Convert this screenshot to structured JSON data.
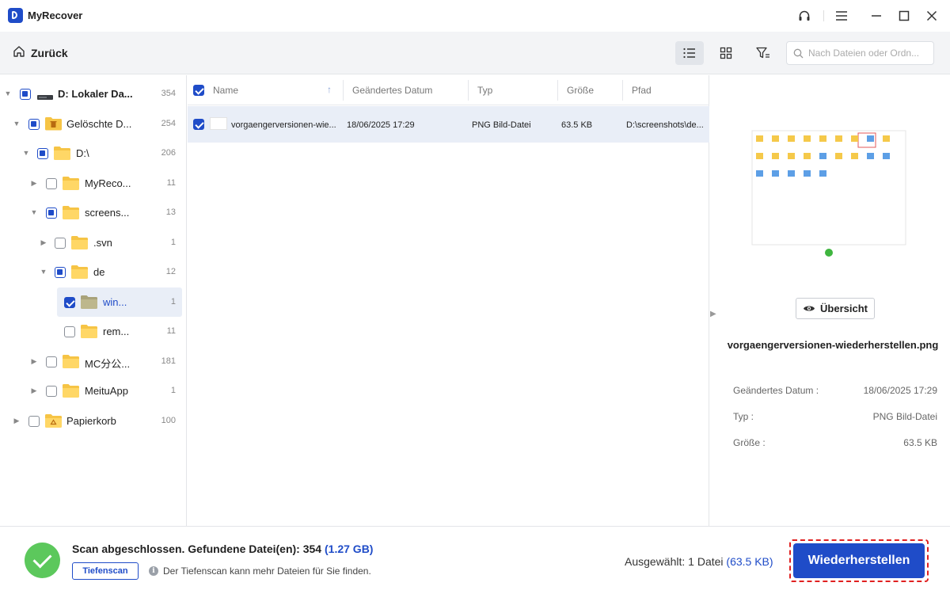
{
  "app": {
    "title": "MyRecover"
  },
  "toolbar": {
    "back_label": "Zurück",
    "search_placeholder": "Nach Dateien oder Ordn..."
  },
  "tree": [
    {
      "label": "D: Lokaler Da...",
      "count": "354"
    },
    {
      "label": "Gelöschte D...",
      "count": "254"
    },
    {
      "label": "D:\\",
      "count": "206"
    },
    {
      "label": "MyReco...",
      "count": "11"
    },
    {
      "label": "screens...",
      "count": "13"
    },
    {
      "label": ".svn",
      "count": "1"
    },
    {
      "label": "de",
      "count": "12"
    },
    {
      "label": "win...",
      "count": "1"
    },
    {
      "label": "rem...",
      "count": "11"
    },
    {
      "label": "MC分公...",
      "count": "181"
    },
    {
      "label": "MeituApp",
      "count": "1"
    },
    {
      "label": "Papierkorb",
      "count": "100"
    }
  ],
  "columns": {
    "name": "Name",
    "modified": "Geändertes Datum",
    "type": "Typ",
    "size": "Größe",
    "path": "Pfad"
  },
  "files": [
    {
      "name": "vorgaengerversionen-wie...",
      "modified": "18/06/2025 17:29",
      "type": "PNG Bild-Datei",
      "size": "63.5 KB",
      "path": "D:\\screenshots\\de..."
    }
  ],
  "preview": {
    "overview_label": "Übersicht",
    "filename": "vorgaengerversionen-wiederherstellen.png",
    "modified_label": "Geändertes Datum :",
    "modified_value": "18/06/2025 17:29",
    "type_label": "Typ :",
    "type_value": "PNG Bild-Datei",
    "size_label": "Größe :",
    "size_value": "63.5 KB"
  },
  "footer": {
    "scan_status": "Scan abgeschlossen. Gefundene Datei(en): 354",
    "scan_size": "(1.27 GB)",
    "deep_scan_label": "Tiefenscan",
    "hint": "Der Tiefenscan kann mehr Dateien für Sie finden.",
    "selected_label": "Ausgewählt: 1 Datei",
    "selected_size": "(63.5 KB)",
    "recover_label": "Wiederherstellen"
  },
  "colors": {
    "accent": "#1f4cc8",
    "success": "#5cc85c",
    "highlight": "#e02020"
  }
}
